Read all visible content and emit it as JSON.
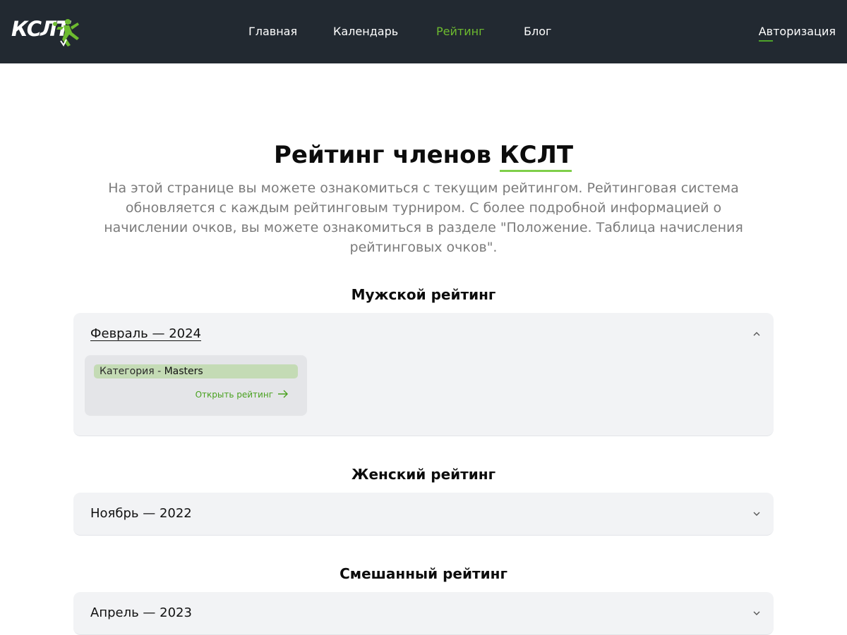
{
  "header": {
    "logo_text": "КСЛТ",
    "nav": [
      {
        "label": "Главная"
      },
      {
        "label": "Календарь"
      },
      {
        "label": "Рейтинг",
        "active": true
      },
      {
        "label": "Блог"
      }
    ],
    "auth_label": "Авторизация",
    "active_color": "#6dbb2f"
  },
  "main": {
    "title_prefix": "Рейтинг членов ",
    "title_accent": "КСЛТ",
    "intro": "На этой странице вы можете ознакомиться с текущим рейтингом. Рейтинговая система обновляется с каждым рейтинговым турниром. С более подробной информацией о начислении очков, вы можете ознакомиться в разделе \"Положение. Таблица начисления рейтинговых очков\"."
  },
  "sections": [
    {
      "title": "Мужской рейтинг",
      "period": "Февраль — 2024",
      "expanded": true,
      "card": {
        "category_prefix": "Категория - ",
        "category_value": "Masters",
        "open_label": "Открыть рейтинг"
      }
    },
    {
      "title": "Женский рейтинг",
      "period": "Ноябрь — 2022",
      "expanded": false
    },
    {
      "title": "Смешанный рейтинг",
      "period": "Апрель — 2023",
      "expanded": false
    }
  ],
  "icons": {
    "chevron_up": "chevron-up-icon",
    "chevron_down": "chevron-down-icon",
    "arrow_right": "arrow-right-icon"
  }
}
